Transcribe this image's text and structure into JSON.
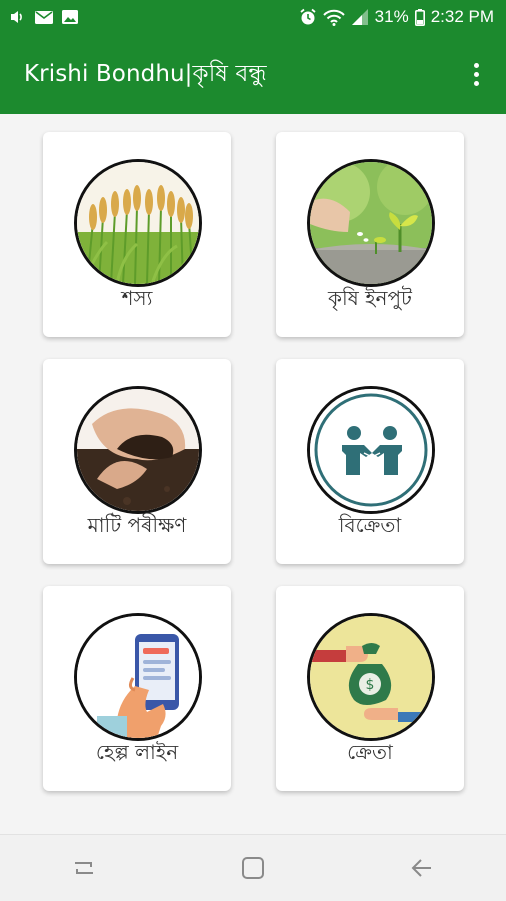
{
  "status_bar": {
    "battery": "31%",
    "time": "2:32 PM",
    "left_icons": [
      "volume-icon",
      "mail-icon",
      "gallery-icon"
    ],
    "right_icons": [
      "alarm-icon",
      "wifi-icon",
      "signal-icon",
      "battery-icon"
    ]
  },
  "app_bar": {
    "title": "Krishi Bondhu|কৃষি বন্ধু",
    "menu_icon": "more-vert-icon",
    "background": "#1c8a2e"
  },
  "menu": {
    "items": [
      {
        "label": "শস্য",
        "icon": "wheat-icon"
      },
      {
        "label": "কৃষি ইনপুট",
        "icon": "seedling-icon"
      },
      {
        "label": "মাটি পৰীক্ষণ",
        "icon": "soil-hands-icon"
      },
      {
        "label": "বিক্ৰেতা",
        "icon": "handshake-icon"
      },
      {
        "label": "হেল্প লাইন",
        "icon": "phone-help-icon"
      },
      {
        "label": "ক্ৰেতা",
        "icon": "money-bag-icon"
      }
    ]
  },
  "nav_bar": {
    "buttons": [
      "recent-apps-icon",
      "home-icon",
      "back-icon"
    ]
  }
}
